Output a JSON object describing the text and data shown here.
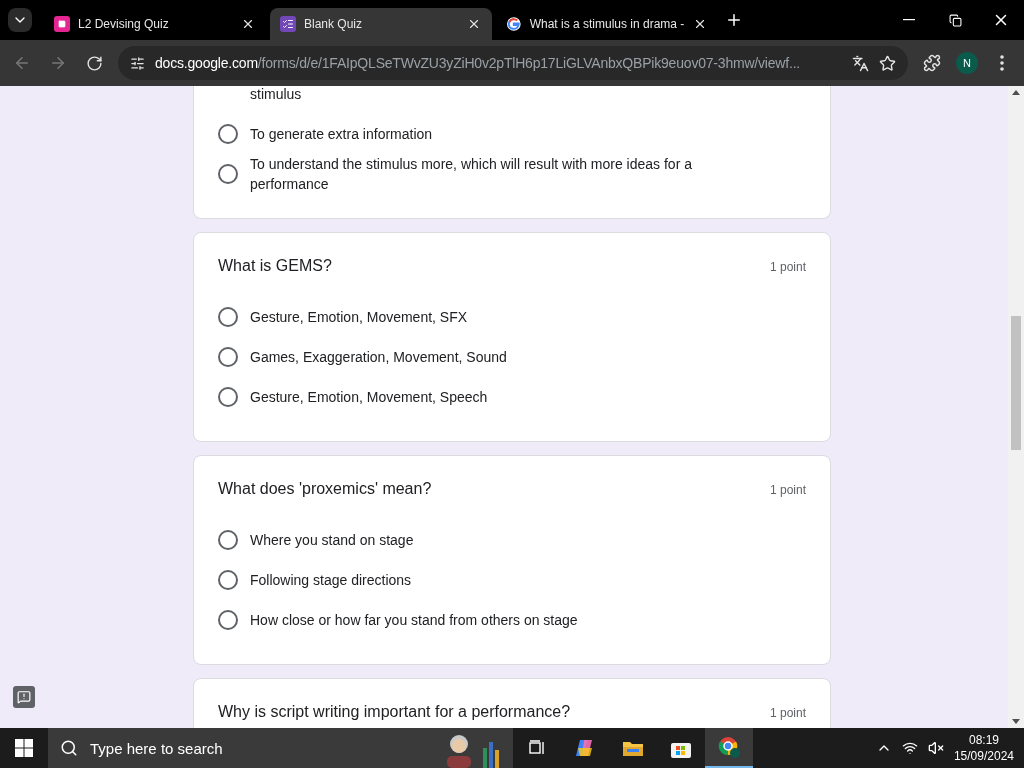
{
  "tabs": [
    {
      "title": "L2 Devising Quiz",
      "selected": false
    },
    {
      "title": "Blank Quiz",
      "selected": true
    },
    {
      "title": "What is a stimulus in drama -",
      "selected": false
    }
  ],
  "address": {
    "host": "docs.google.com",
    "path": "/forms/d/e/1FAIpQLSeTWvZU3yZiH0v2pTlH6p17LiGLVAnbxQBPik9euov07-3hmw/viewf..."
  },
  "profile": "N",
  "cards": [
    {
      "cut_text": "stimulus",
      "options": [
        {
          "text": "To generate extra information",
          "selected": false
        },
        {
          "text": "To understand the stimulus more, which will result with more ideas for a performance",
          "selected": false
        }
      ]
    },
    {
      "title": "What is GEMS?",
      "points": "1 point",
      "options": [
        {
          "text": "Gesture, Emotion, Movement, SFX",
          "selected": false
        },
        {
          "text": "Games, Exaggeration, Movement, Sound",
          "selected": false
        },
        {
          "text": "Gesture, Emotion, Movement, Speech",
          "selected": false
        }
      ]
    },
    {
      "title": "What does 'proxemics' mean?",
      "points": "1 point",
      "options": [
        {
          "text": "Where you stand on stage",
          "selected": false
        },
        {
          "text": "Following stage directions",
          "selected": false
        },
        {
          "text": "How close or how far you stand from others on stage",
          "selected": false
        }
      ]
    },
    {
      "title": "Why is script writing important for a performance?",
      "points": "1 point"
    }
  ],
  "taskbar": {
    "search_placeholder": "Type here to search",
    "time": "08:19",
    "date": "15/09/2024"
  }
}
